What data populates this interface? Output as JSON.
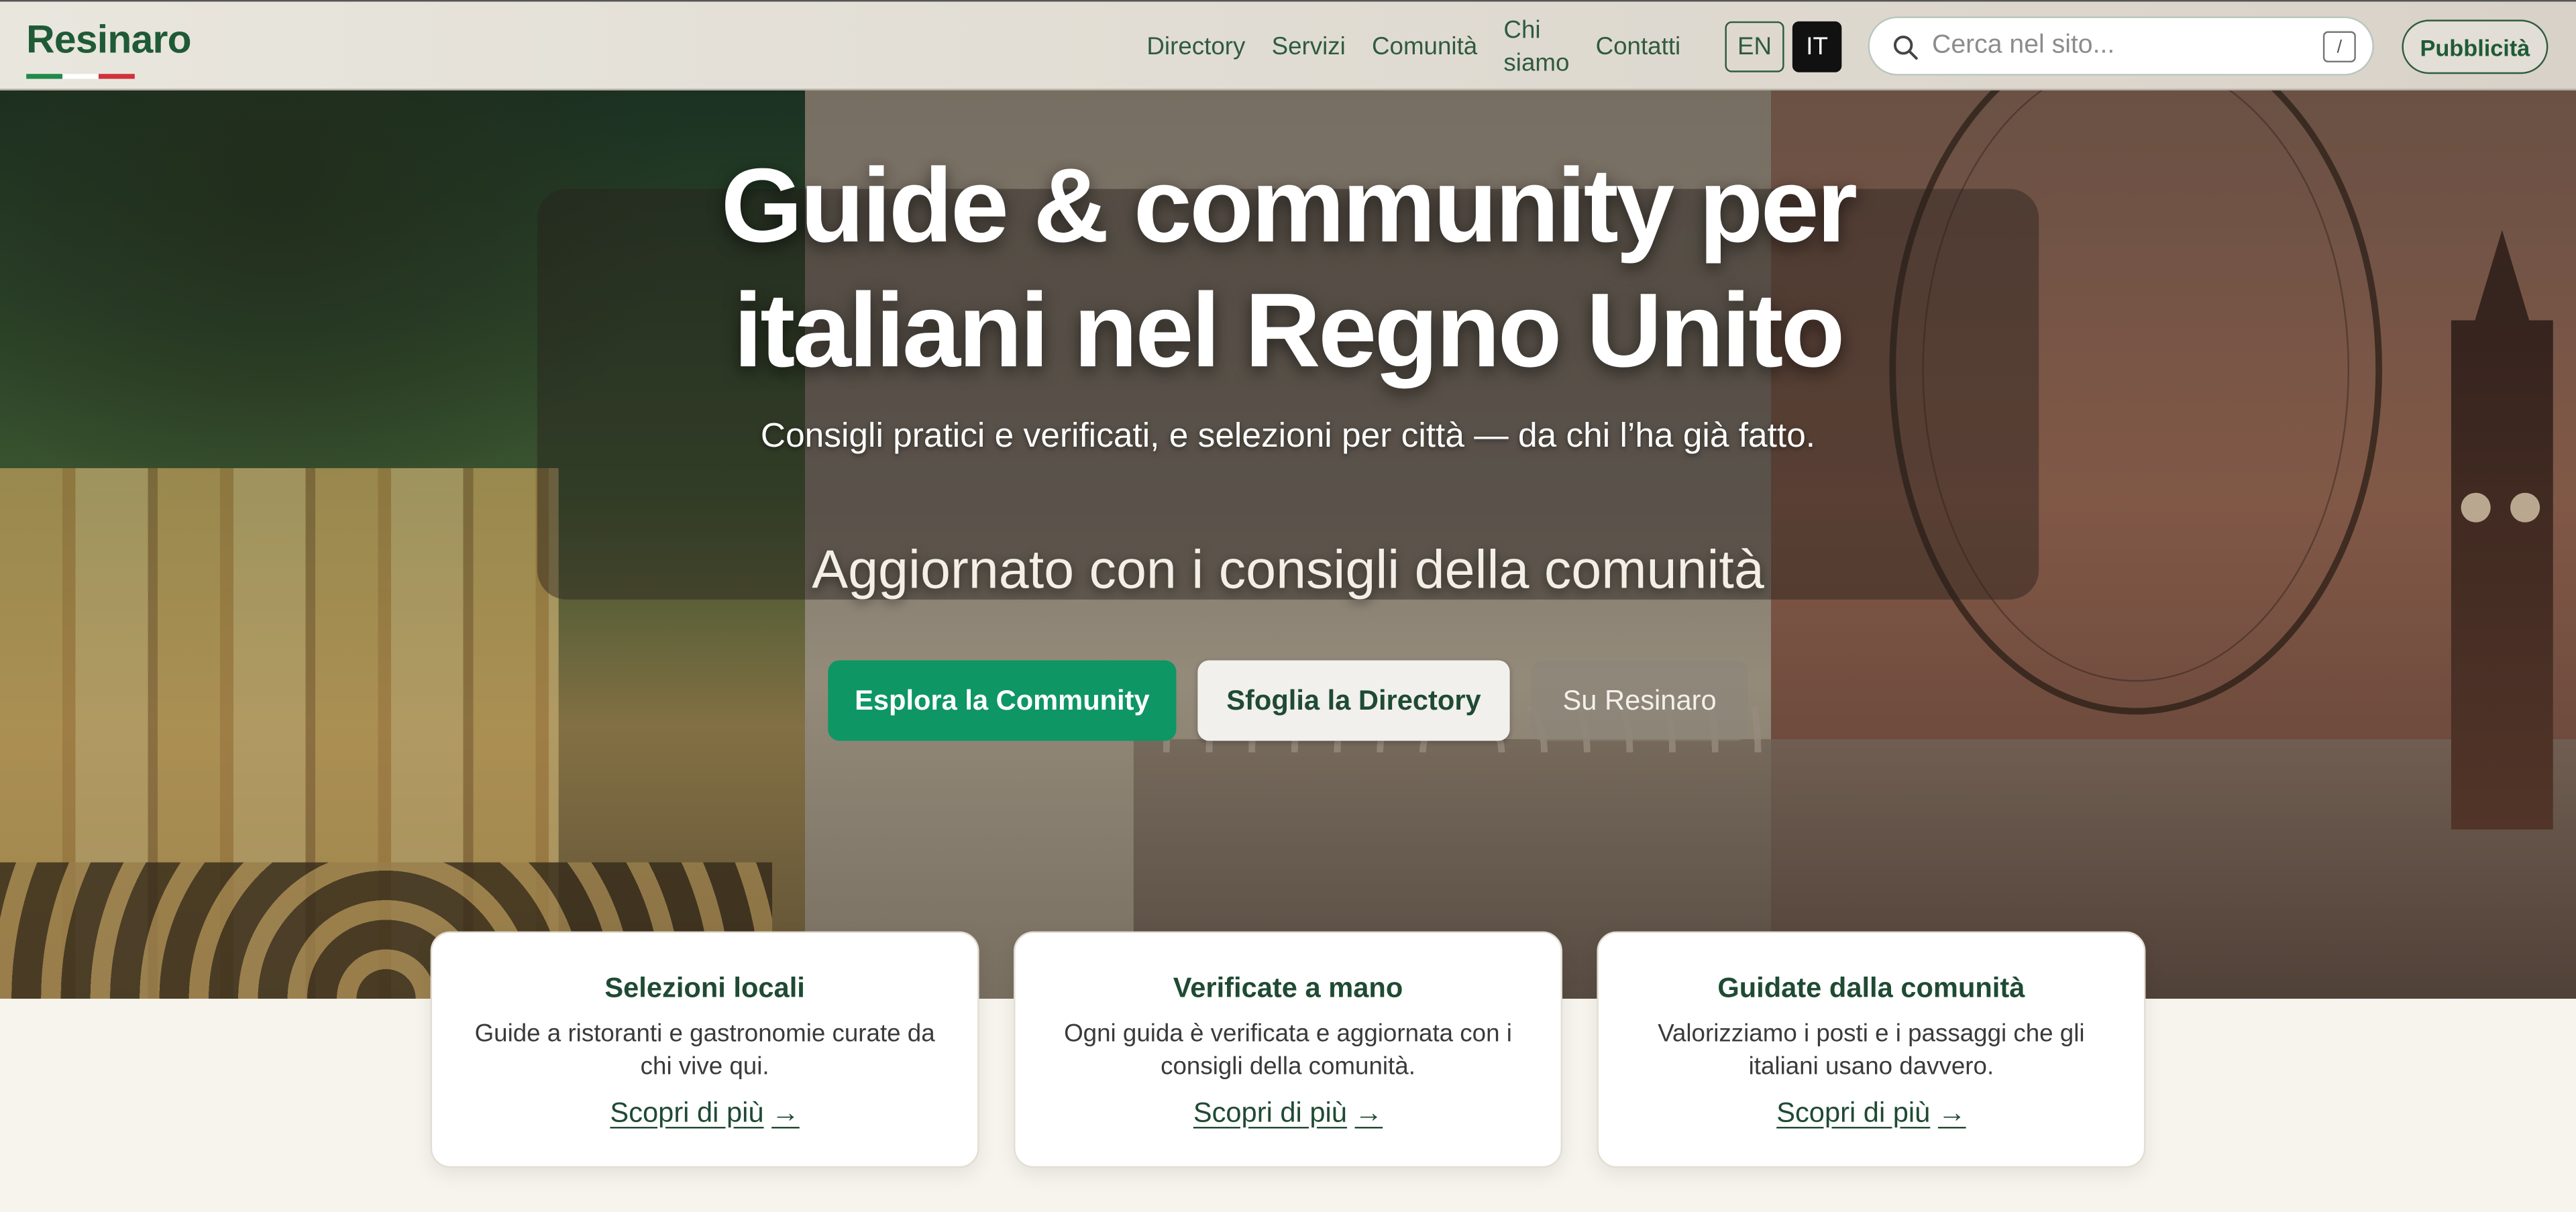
{
  "header": {
    "logo": "Resinaro",
    "nav": [
      "Directory",
      "Servizi",
      "Comunità",
      "Chi\nsiamo",
      "Contatti"
    ],
    "lang": {
      "en": "EN",
      "it": "IT",
      "active": "IT"
    },
    "search": {
      "placeholder": "Cerca nel sito...",
      "shortcut": "/"
    },
    "cta": "Pubblicità"
  },
  "hero": {
    "title_line1": "Guide & community per",
    "title_line2": "italiani nel Regno Unito",
    "subtitle": "Consigli pratici e verificati, e selezioni per città — da chi l’ha già fatto.",
    "updated": "Aggiornato con i consigli della comunità",
    "buttons": [
      "Esplora la Community",
      "Sfoglia la Directory",
      "Su Resinaro"
    ]
  },
  "cards": [
    {
      "title": "Selezioni locali",
      "desc": "Guide a ristoranti e gastronomie curate da chi vive qui.",
      "link": "Scopri di più",
      "arrow": "→"
    },
    {
      "title": "Verificate a mano",
      "desc": "Ogni guida è verificata e aggiornata con i consigli della comunità.",
      "link": "Scopri di più",
      "arrow": "→"
    },
    {
      "title": "Guidate dalla comunità",
      "desc": "Valorizziamo i posti e i passaggi che gli italiani usano davvero.",
      "link": "Scopri di più",
      "arrow": "→"
    }
  ],
  "colors": {
    "brand": "#1f5a36",
    "accent": "#0e9664",
    "flag": [
      "#1f8a4a",
      "#ffffff",
      "#d0323a"
    ]
  }
}
